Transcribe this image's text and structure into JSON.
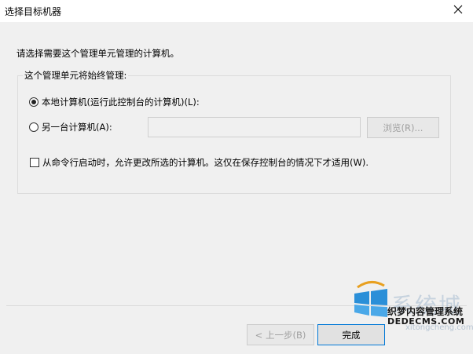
{
  "window": {
    "title": "选择目标机器"
  },
  "dialog": {
    "instruction": "请选择需要这个管理单元管理的计算机。",
    "group_label": "这个管理单元将始终管理:",
    "radio_local": {
      "label": "本地计算机(运行此控制台的计算机)(L):",
      "checked": true
    },
    "radio_other": {
      "label": "另一台计算机(A):",
      "checked": false
    },
    "other_computer_input": {
      "value": ""
    },
    "browse_label": "浏览(R)...",
    "checkbox_allow": {
      "label": "从命令行启动时，允许更改所选的计算机。这仅在保存控制台的情况下才适用(W).",
      "checked": false
    }
  },
  "footer": {
    "back_label": "< 上一步(B)",
    "finish_label": "完成"
  },
  "watermark": {
    "brand_cn": "系统城",
    "site": "xitongcheng.com",
    "cms_cn": "织梦内容管理系统",
    "cms_site": "DEDECMS.COM"
  },
  "colors": {
    "dialog_bg": "#f0f0f0",
    "accent": "#0078d7",
    "disabled_text": "#a0a0a0"
  }
}
